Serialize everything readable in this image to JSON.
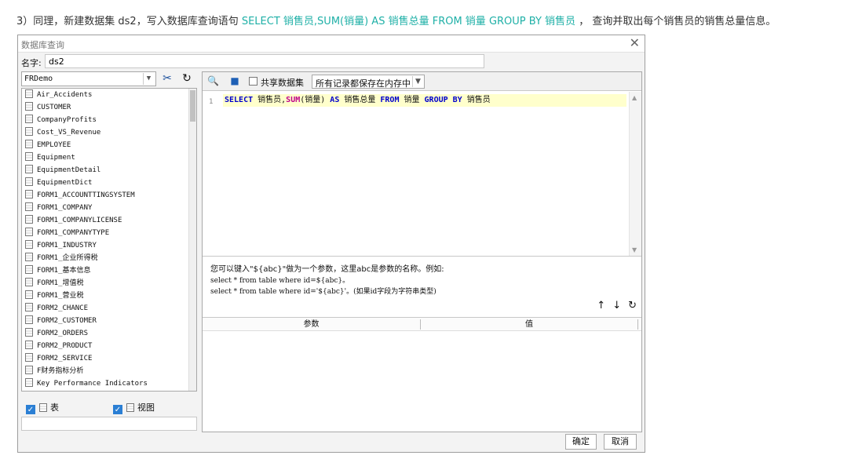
{
  "intro": {
    "prefix": "3）同理，新建数据集 ds2，写入数据库查询语句 ",
    "sql": "SELECT 销售员,SUM(销量) AS 销售总量 FROM 销量 GROUP BY 销售员",
    "suffix": " ， 查询并取出每个销售员的销售总量信息。"
  },
  "dialog": {
    "title": "数据库查询",
    "close_glyph": "✕",
    "name_label": "名字:",
    "name_value": "ds2",
    "connection": "FRDemo",
    "tables": [
      "Air_Accidents",
      "CUSTOMER",
      "CompanyProfits",
      "Cost_VS_Revenue",
      "EMPLOYEE",
      "Equipment",
      "EquipmentDetail",
      "EquipmentDict",
      "FORM1_ACCOUNTTINGSYSTEM",
      "FORM1_COMPANY",
      "FORM1_COMPANYLICENSE",
      "FORM1_COMPANYTYPE",
      "FORM1_INDUSTRY",
      "FORM1_企业所得税",
      "FORM1_基本信息",
      "FORM1_增值税",
      "FORM1_营业税",
      "FORM2_CHANCE",
      "FORM2_CUSTOMER",
      "FORM2_ORDERS",
      "FORM2_PRODUCT",
      "FORM2_SERVICE",
      "F财务指标分析",
      "Key Performance Indicators"
    ],
    "check_table_label": "表",
    "check_view_label": "视图",
    "share_label": "共享数据集",
    "memory_option": "所有记录都保存在内存中",
    "line_number": "1",
    "sql_parts": {
      "k1": "SELECT",
      "t1": " 销售员,",
      "fn": "SUM",
      "t2": "(销量) ",
      "k2": "AS",
      "t3": " 销售总量 ",
      "k3": "FROM",
      "t4": " 销量 ",
      "k4": "GROUP BY",
      "t5": " 销售员"
    },
    "help_line1": "您可以键入\"${abc}\"做为一个参数，这里abc是参数的名称。例如:",
    "help_line2": "select * from table where id=${abc}。",
    "help_line3": "select * from table where id='${abc}'。(如果id字段为字符串类型)",
    "param_col": "参数",
    "value_col": "值",
    "ok": "确定",
    "cancel": "取消"
  }
}
